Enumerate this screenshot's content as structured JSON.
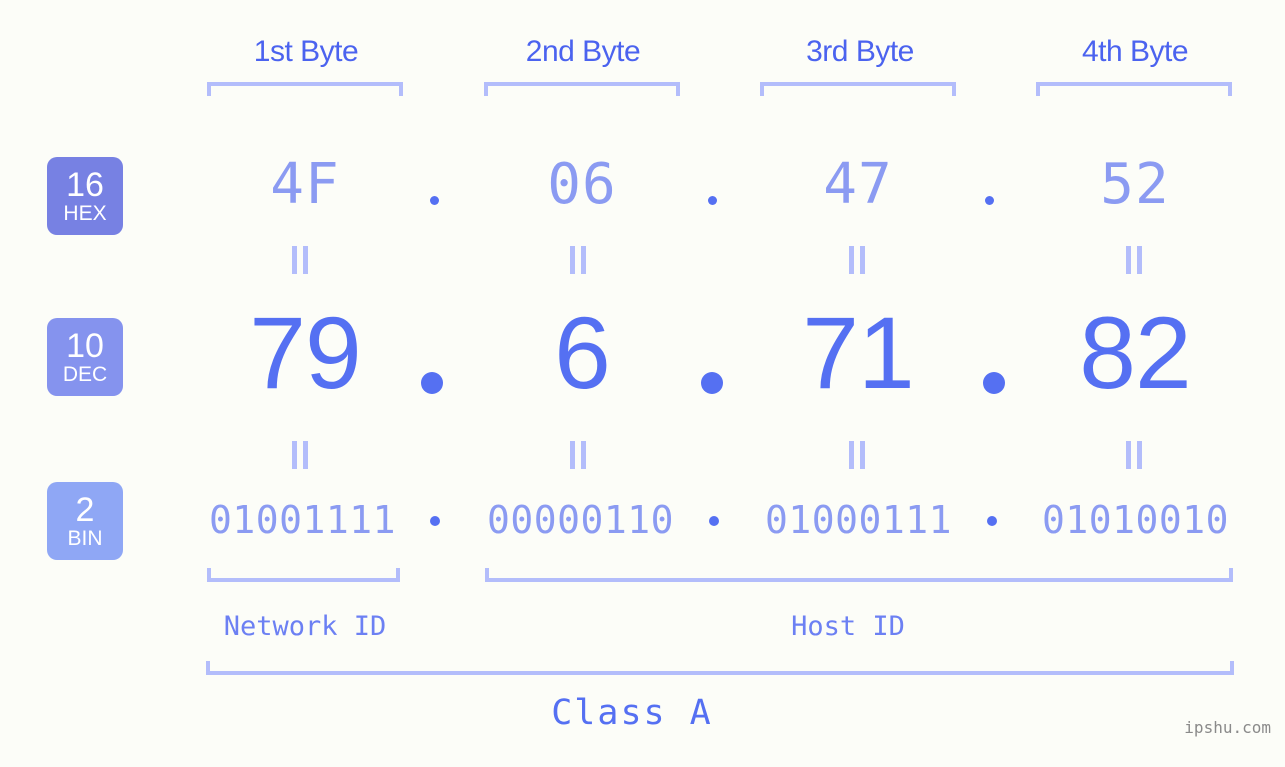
{
  "colors": {
    "background": "#fcfdf8",
    "bracket": "#b3bdfb",
    "hex_text": "#8b9bf2",
    "dec_text": "#5570f2",
    "bin_text": "#8b9bf2",
    "byte_label": "#4b63ef",
    "badge_hex": "#7781e3",
    "badge_dec": "#8593ee",
    "badge_bin": "#8fa7f5",
    "watermark": "#8a8a8a"
  },
  "byte_headers": [
    {
      "label": "1st Byte"
    },
    {
      "label": "2nd Byte"
    },
    {
      "label": "3rd Byte"
    },
    {
      "label": "4th Byte"
    }
  ],
  "bases": [
    {
      "number": "16",
      "name": "HEX"
    },
    {
      "number": "10",
      "name": "DEC"
    },
    {
      "number": "2",
      "name": "BIN"
    }
  ],
  "rows": {
    "hex": {
      "values": [
        "4F",
        "06",
        "47",
        "52"
      ]
    },
    "dec": {
      "values": [
        "79",
        "6",
        "71",
        "82"
      ]
    },
    "bin": {
      "values": [
        "01001111",
        "00000110",
        "01000111",
        "01010010"
      ]
    }
  },
  "separators": {
    "dot": ".",
    "equals": "="
  },
  "segments": [
    {
      "label": "Network ID"
    },
    {
      "label": "Host ID"
    }
  ],
  "class": {
    "label": "Class A"
  },
  "watermark": {
    "text": "ipshu.com"
  }
}
